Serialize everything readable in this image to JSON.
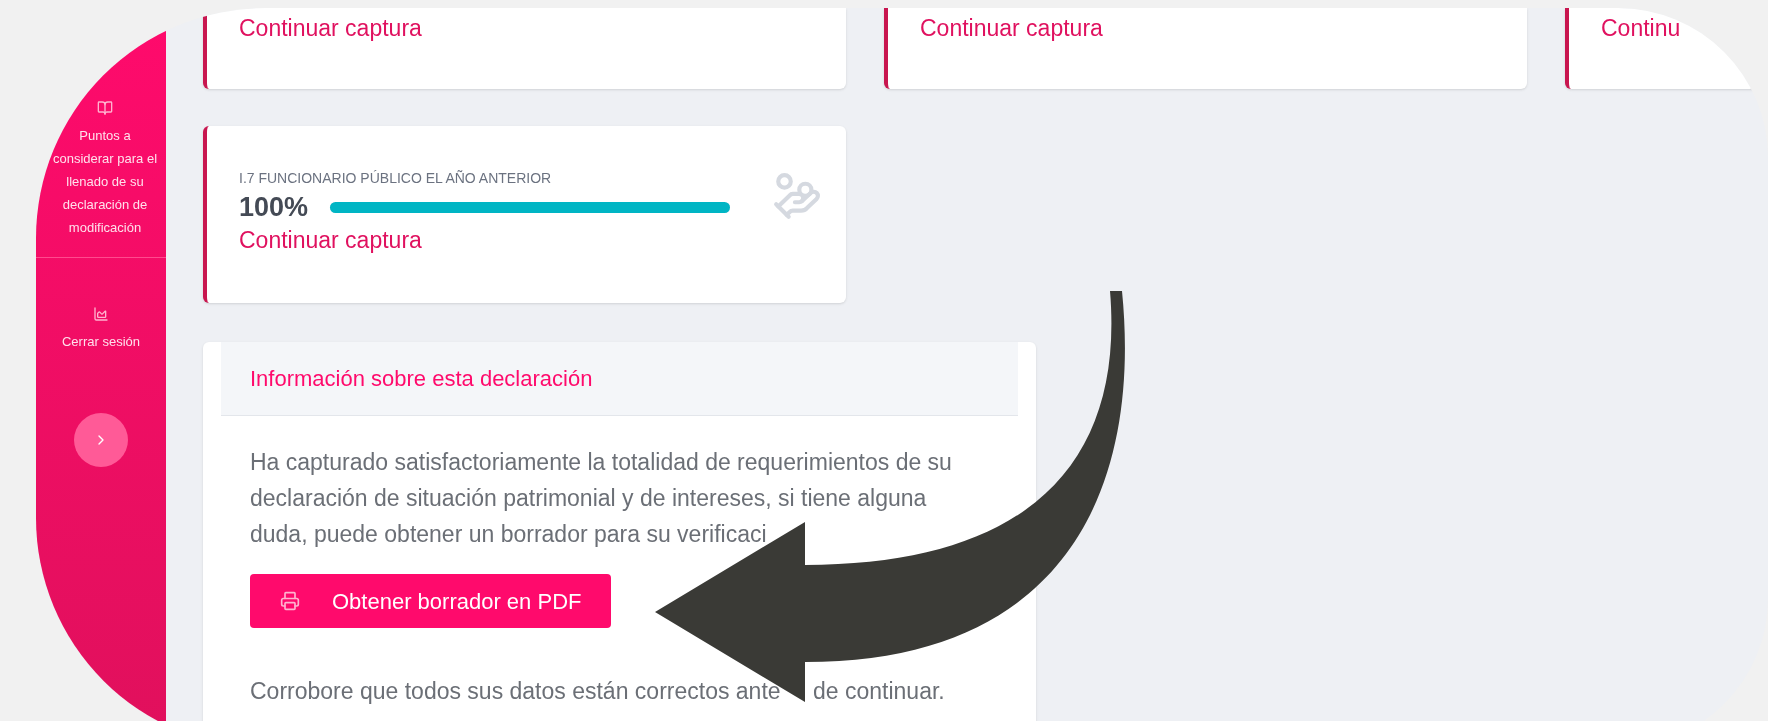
{
  "sidebar": {
    "items": [
      {
        "kind": "book",
        "label": "Puntos a considerar para el llenado de su declaración de modificación"
      },
      {
        "kind": "chart",
        "label": "Cerrar sesión"
      }
    ]
  },
  "cards": [
    {
      "link": "Continuar captura"
    },
    {
      "link": "Continuar captura"
    },
    {
      "link": "Continu"
    }
  ],
  "progress_card": {
    "title": "I.7 FUNCIONARIO PÚBLICO EL AÑO ANTERIOR",
    "percent": "100%",
    "level": 1,
    "link": "Continuar captura"
  },
  "info": {
    "title": "Información sobre esta declaración",
    "body": "Ha capturado satisfactoriamente la totalidad de requerimientos de su declaración de situación patrimonial y de intereses, si tiene alguna duda, puede obtener un borrador para su verificaci",
    "button": "Obtener borrador en PDF",
    "note_start": "Corrobore que todos sus datos están correctos ante",
    "note_end": "de continuar."
  }
}
